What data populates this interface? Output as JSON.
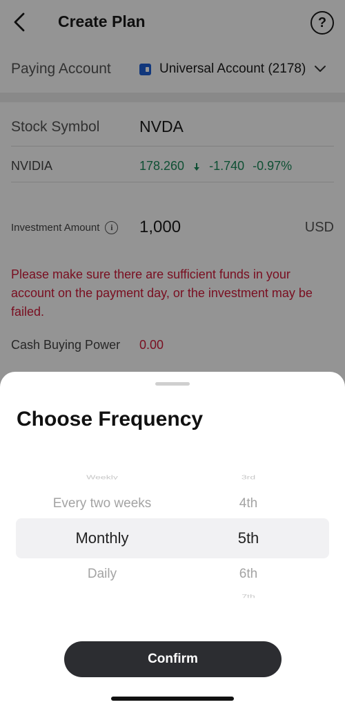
{
  "header": {
    "title": "Create Plan",
    "help_label": "?"
  },
  "paying_account": {
    "label": "Paying Account",
    "account_name": "Universal Account (2178)"
  },
  "stock": {
    "symbol_label": "Stock Symbol",
    "symbol": "NVDA",
    "name": "NVIDIA",
    "price": "178.260",
    "change": "-1.740",
    "change_pct": "-0.97%",
    "quote_color": "#1b8a5a"
  },
  "investment": {
    "label": "Investment Amount",
    "amount": "1,000",
    "currency": "USD"
  },
  "warning_text": "Please make sure there are sufficient funds in your account on the payment day, or the investment may be failed.",
  "buying_power": {
    "label": "Cash Buying Power",
    "value": "0.00",
    "value_color": "#d11a3a"
  },
  "sheet": {
    "title": "Choose Frequency",
    "frequency_options": {
      "far_above": "Weekly",
      "above": "Every two weeks",
      "selected": "Monthly",
      "below": "Daily"
    },
    "day_options": {
      "far_above": "3rd",
      "above": "4th",
      "selected": "5th",
      "below": "6th",
      "far_below": "7th"
    },
    "confirm_label": "Confirm"
  }
}
